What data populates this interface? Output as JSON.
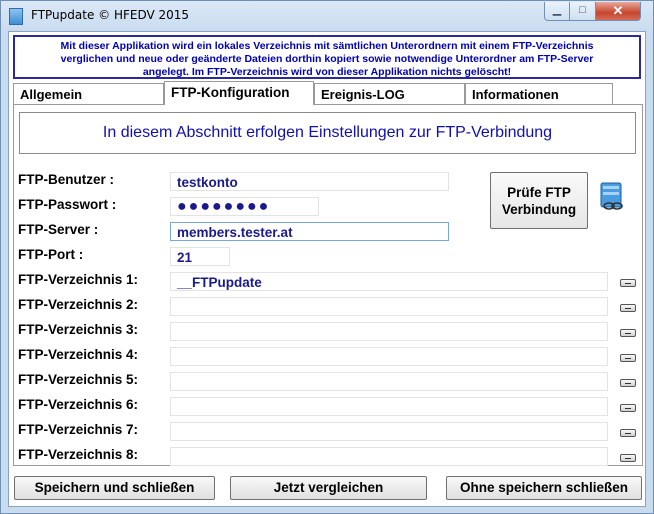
{
  "window": {
    "title": "FTPupdate © HFEDV 2015",
    "minimize_glyph": "▁",
    "maximize_glyph": "□",
    "close_glyph": "✕"
  },
  "info_text": {
    "line1": "Mit dieser Applikation wird ein lokales Verzeichnis mit sämtlichen Unterordnern mit einem FTP-Verzeichnis",
    "line2": "verglichen und neue oder geänderte Dateien dorthin kopiert sowie notwendige Unterordner am FTP-Server",
    "line3": "angelegt. Im FTP-Verzeichnis wird von dieser Applikation nichts gelöscht!"
  },
  "tabs": [
    {
      "label": "Allgemein",
      "active": false
    },
    {
      "label": "FTP-Konfiguration",
      "active": true
    },
    {
      "label": "Ereignis-LOG",
      "active": false
    },
    {
      "label": "Informationen",
      "active": false
    }
  ],
  "section_heading": "In diesem Abschnitt erfolgen  Einstellungen zur FTP-Verbindung",
  "form": {
    "user_label": "FTP-Benutzer :",
    "user_value": "testkonto",
    "password_label": "FTP-Passwort :",
    "password_value": "●●●●●●●●",
    "server_label": "FTP-Server :",
    "server_value": "members.tester.at",
    "port_label": "FTP-Port :",
    "port_value": "21"
  },
  "check_button": {
    "line1": "Prüfe FTP",
    "line2": "Verbindung"
  },
  "directories": [
    {
      "label": "FTP-Verzeichnis 1:",
      "value": "__FTPupdate"
    },
    {
      "label": "FTP-Verzeichnis 2:",
      "value": ""
    },
    {
      "label": "FTP-Verzeichnis 3:",
      "value": ""
    },
    {
      "label": "FTP-Verzeichnis 4:",
      "value": ""
    },
    {
      "label": "FTP-Verzeichnis 5:",
      "value": ""
    },
    {
      "label": "FTP-Verzeichnis 6:",
      "value": ""
    },
    {
      "label": "FTP-Verzeichnis 7:",
      "value": ""
    },
    {
      "label": "FTP-Verzeichnis 8:",
      "value": ""
    }
  ],
  "buttons": {
    "save_close": "Speichern und schließen",
    "compare_now": "Jetzt vergleichen",
    "close_without_save": "Ohne speichern schließen"
  },
  "icons": {
    "app": "app-icon",
    "database_link": "database-link-icon"
  }
}
